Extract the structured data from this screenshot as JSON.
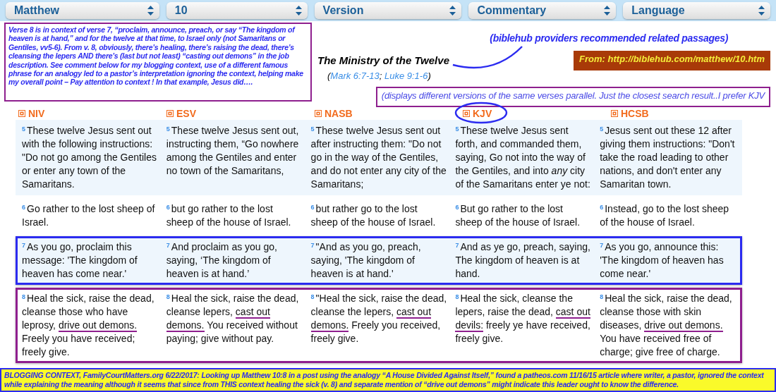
{
  "selectors": [
    {
      "label": "Matthew"
    },
    {
      "label": "10"
    },
    {
      "label": "Version"
    },
    {
      "label": "Commentary"
    },
    {
      "label": "Language"
    }
  ],
  "note": "Verse 8 is in context of verse 7, “proclaim, announce, preach, or say “The kingdom of heaven is at hand,” and for the twelve at that time, to Israel only (not Samaritans or Gentiles, vv5-6). From v. 8, obviously, there’s healing, there’s raising the dead, there’s cleansing the lepers AND there’s (last but not least) “casting out demons” in the job description. See comment below for my blogging context, use of a different famous phrase for an analogy led to a pastor’s interpretation ignoring the context, helping make my overall point – Pay attention to context ! In that example, Jesus did….",
  "passage": {
    "title": "The Ministry of the Twelve",
    "references": [
      {
        "text": "(",
        "link": false
      },
      {
        "text": "Mark 6:7-13",
        "link": true
      },
      {
        "text": "; ",
        "link": false
      },
      {
        "text": "Luke 9:1-6",
        "link": true
      },
      {
        "text": ")",
        "link": false
      }
    ]
  },
  "related_note": "(biblehub providers recommended related passages)",
  "source_banner": "From:  http://biblehub.com/matthew/10.htm",
  "versions_note": "(displays different versions of the same verses parallel.  Just the closest search result..I prefer KJV",
  "versions": [
    {
      "label": "NIV",
      "circled": false
    },
    {
      "label": "ESV",
      "circled": false
    },
    {
      "label": "NASB",
      "circled": false
    },
    {
      "label": "KJV",
      "circled": true
    },
    {
      "label": "HCSB",
      "circled": false
    }
  ],
  "rows": [
    {
      "cells": [
        {
          "number": "5",
          "segments": [
            {
              "text": "These twelve Jesus sent out with the following instructions: \"Do not go among the Gentiles or enter any town of the Samaritans.",
              "marked": false
            }
          ]
        },
        {
          "number": "5",
          "segments": [
            {
              "text": "These twelve Jesus sent out, instructing them, “Go nowhere among the Gentiles and enter no town of the Samaritans,",
              "marked": false
            }
          ]
        },
        {
          "number": "5",
          "segments": [
            {
              "text": "These twelve Jesus sent out after instructing them: \"Do not go in the way of the Gentiles, and do not enter any city of the Samaritans;",
              "marked": false
            }
          ]
        },
        {
          "number": "5",
          "segments": [
            {
              "text": "These twelve Jesus sent forth, and commanded them, saying, Go not into the way of the Gentiles, and into *any* city of the Samaritans enter ye not:",
              "marked": false
            }
          ]
        },
        {
          "number": "5",
          "segments": [
            {
              "text": "Jesus sent out these 12 after giving them instructions: \"Don't take the road leading to other nations, and don't enter any Samaritan town.",
              "marked": false
            }
          ]
        }
      ]
    },
    {
      "cells": [
        {
          "number": "6",
          "segments": [
            {
              "text": "Go rather to the lost sheep of Israel.",
              "marked": false
            }
          ]
        },
        {
          "number": "6",
          "segments": [
            {
              "text": "but go rather to the lost sheep of the house of Israel.",
              "marked": false
            }
          ]
        },
        {
          "number": "6",
          "segments": [
            {
              "text": "but rather go to the lost sheep of the house of Israel.",
              "marked": false
            }
          ]
        },
        {
          "number": "6",
          "segments": [
            {
              "text": "But go rather to the lost sheep of the house of Israel.",
              "marked": false
            }
          ]
        },
        {
          "number": "6",
          "segments": [
            {
              "text": "Instead, go to the lost sheep of the house of Israel.",
              "marked": false
            }
          ]
        }
      ]
    },
    {
      "color": "#2b2bf0",
      "cells": [
        {
          "number": "7",
          "segments": [
            {
              "text": "As you go, proclaim this message: 'The kingdom of heaven has come near.'",
              "marked": false
            }
          ]
        },
        {
          "number": "7",
          "segments": [
            {
              "text": "And proclaim as you go, saying, ‘The kingdom of heaven is at hand.’",
              "marked": false
            }
          ]
        },
        {
          "number": "7",
          "segments": [
            {
              "text": "\"And as you go, preach, saying, 'The kingdom of heaven is at hand.'",
              "marked": false
            }
          ]
        },
        {
          "number": "7",
          "segments": [
            {
              "text": "And as ye go, preach, saying, The kingdom of heaven is at hand.",
              "marked": false
            }
          ]
        },
        {
          "number": "7",
          "segments": [
            {
              "text": "As you go, announce this: 'The kingdom of heaven has come near.'",
              "marked": false
            }
          ]
        }
      ]
    },
    {
      "color": "#8e1f8e",
      "cells": [
        {
          "number": "8",
          "segments": [
            {
              "text": "Heal the sick, raise the dead, cleanse those who have leprosy, ",
              "marked": false
            },
            {
              "text": "drive out demons.",
              "marked": true
            },
            {
              "text": " Freely you have received; freely give.",
              "marked": false
            }
          ]
        },
        {
          "number": "8",
          "segments": [
            {
              "text": "Heal the sick, raise the dead, cleanse lepers, ",
              "marked": false
            },
            {
              "text": "cast out demons.",
              "marked": true
            },
            {
              "text": " You received without paying; give without pay.",
              "marked": false
            }
          ]
        },
        {
          "number": "8",
          "segments": [
            {
              "text": "\"Heal the sick, raise the dead, cleanse the lepers, ",
              "marked": false
            },
            {
              "text": "cast out demons.",
              "marked": true
            },
            {
              "text": " Freely you received, freely give.",
              "marked": false
            }
          ]
        },
        {
          "number": "8",
          "segments": [
            {
              "text": "Heal the sick, cleanse the lepers, raise the dead, ",
              "marked": false
            },
            {
              "text": "cast out devils:",
              "marked": true
            },
            {
              "text": " freely ye have received, freely give.",
              "marked": false
            }
          ]
        },
        {
          "number": "8",
          "segments": [
            {
              "text": "Heal the sick, raise the dead, cleanse those with skin diseases, ",
              "marked": false
            },
            {
              "text": "drive out demons.",
              "marked": true
            },
            {
              "text": " You have received free of charge; give free of charge.",
              "marked": false
            }
          ]
        }
      ]
    }
  ],
  "blogging_context": "BLOGGING CONTEXT, FamilyCourtMatters.org 6/22/2017: Looking up Matthew 10:8 in a post using the analogy “A House Divided Against Itself,” found a patheos.com 11/16/15 article where writer, a pastor, ignored the context while explaining the meaning although it seems that since from THIS context  healing the sick (v. 8) and separate mention of “drive out demons” might indicate this leader ought to know the difference."
}
